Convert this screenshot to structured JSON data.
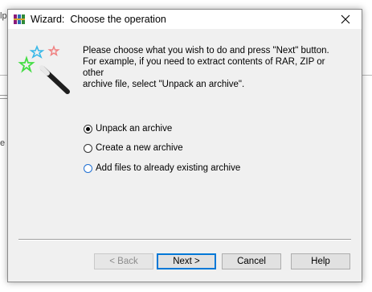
{
  "background": {
    "help_fragment": "lp",
    "side_fragment": "e ."
  },
  "dialog": {
    "title_prefix": "Wizard:",
    "title": "Choose the operation",
    "intro_lines": [
      "Please choose what you wish to do and press \"Next\" button.",
      "For example, if you need to extract contents of RAR, ZIP or other",
      "archive file, select \"Unpack an archive\"."
    ],
    "options": [
      {
        "label": "Unpack an archive",
        "selected": true
      },
      {
        "label": "Create a new archive",
        "selected": false
      },
      {
        "label": "Add files to already existing archive",
        "selected": false
      }
    ],
    "buttons": {
      "back": "< Back",
      "next": "Next >",
      "cancel": "Cancel",
      "help": "Help"
    }
  },
  "icons": {
    "app": "winrar-books-icon",
    "close": "close-icon",
    "wizard": "magic-wand-icon"
  },
  "colors": {
    "dialog_bg": "#f0f0f0",
    "accent_focus": "#0078d7"
  }
}
